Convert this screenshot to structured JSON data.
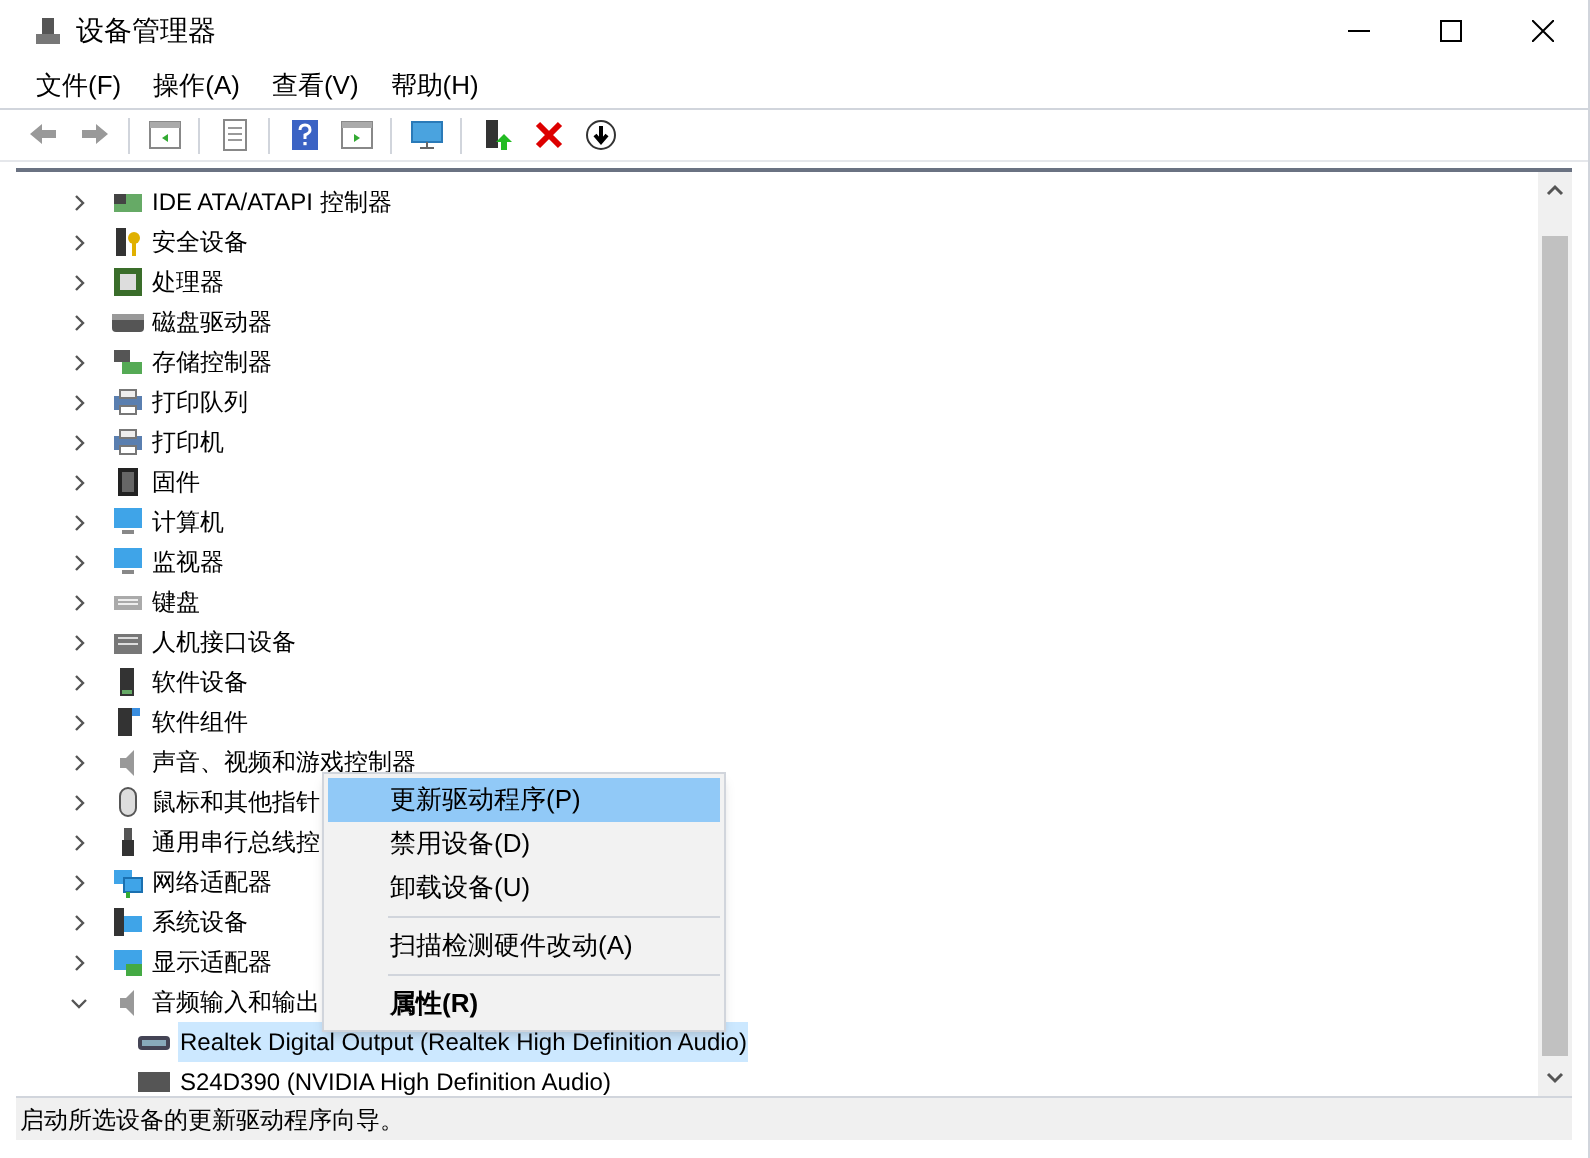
{
  "window": {
    "title": "设备管理器"
  },
  "menu_bar": [
    "文件(F)",
    "操作(A)",
    "查看(V)",
    "帮助(H)"
  ],
  "tree": [
    {
      "label": "IDE ATA/ATAPI 控制器",
      "expanded": false,
      "selected": false
    },
    {
      "label": "安全设备",
      "expanded": false,
      "selected": false
    },
    {
      "label": "处理器",
      "expanded": false,
      "selected": false
    },
    {
      "label": "磁盘驱动器",
      "expanded": false,
      "selected": false
    },
    {
      "label": "存储控制器",
      "expanded": false,
      "selected": false
    },
    {
      "label": "打印队列",
      "expanded": false,
      "selected": false
    },
    {
      "label": "打印机",
      "expanded": false,
      "selected": false
    },
    {
      "label": "固件",
      "expanded": false,
      "selected": false
    },
    {
      "label": "计算机",
      "expanded": false,
      "selected": false
    },
    {
      "label": "监视器",
      "expanded": false,
      "selected": false
    },
    {
      "label": "键盘",
      "expanded": false,
      "selected": false
    },
    {
      "label": "人机接口设备",
      "expanded": false,
      "selected": false
    },
    {
      "label": "软件设备",
      "expanded": false,
      "selected": false
    },
    {
      "label": "软件组件",
      "expanded": false,
      "selected": false
    },
    {
      "label": "声音、视频和游戏控制器",
      "expanded": false,
      "selected": false
    },
    {
      "label": "鼠标和其他指针",
      "expanded": false,
      "selected": false
    },
    {
      "label": "通用串行总线控",
      "expanded": false,
      "selected": false
    },
    {
      "label": "网络适配器",
      "expanded": false,
      "selected": false
    },
    {
      "label": "系统设备",
      "expanded": false,
      "selected": false
    },
    {
      "label": "显示适配器",
      "expanded": false,
      "selected": false
    },
    {
      "label": "音频输入和输出",
      "expanded": true,
      "selected": false,
      "children": [
        {
          "label": "Realtek Digital Output (Realtek High Definition Audio)",
          "selected": true
        },
        {
          "label": "S24D390 (NVIDIA High Definition Audio)",
          "selected": false
        }
      ]
    }
  ],
  "context_menu": [
    {
      "label": "更新驱动程序(P)",
      "selected": true,
      "bold": false
    },
    {
      "label": "禁用设备(D)",
      "selected": false,
      "bold": false
    },
    {
      "label": "卸载设备(U)",
      "selected": false,
      "bold": false
    },
    {
      "kind": "separator"
    },
    {
      "label": "扫描检测硬件改动(A)",
      "selected": false,
      "bold": false
    },
    {
      "kind": "separator"
    },
    {
      "label": "属性(R)",
      "selected": false,
      "bold": true
    }
  ],
  "status_bar": "启动所选设备的更新驱动程序向导。"
}
